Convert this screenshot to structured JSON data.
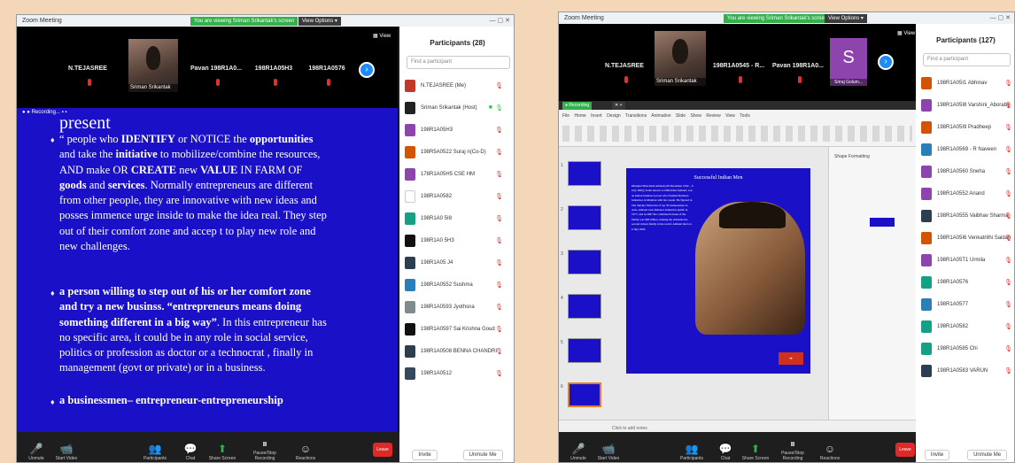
{
  "left": {
    "window_title": "Zoom Meeting",
    "banner": "You are viewing Sriman Srikantak's screen",
    "view_options": "View Options ▾",
    "gallery": [
      {
        "name": "N.TEJASREE"
      },
      {
        "name": "Sriman Srikantak"
      },
      {
        "name": "Pavan 198R1A0..."
      },
      {
        "name": "198R1A05H3"
      },
      {
        "name": "198R1A0576"
      }
    ],
    "view_label": "View",
    "recording": "Recording...",
    "slide": {
      "title": "present",
      "p1_l1_a": "“ people who ",
      "p1_l1_b": "IDENTIFY",
      "p1_l1_c": " or NOTICE the ",
      "p1_l1_d": "opportunities",
      "p1_l2_a": "and take the ",
      "p1_l2_b": "initiative",
      "p1_l2_c": " to mobilizee/combine the resources,",
      "p1_l3_a": "AND make OR ",
      "p1_l3_b": "CREATE",
      "p1_l3_c": " new ",
      "p1_l3_d": "VALUE",
      "p1_l3_e": " IN FARM OF",
      "p1_l4_a": "goods",
      "p1_l4_b": " and ",
      "p1_l4_c": "services",
      "p1_l4_d": ". Normally  entrepreneurs are  different",
      "p1_l5": "from other people, they are innovative with new  ideas and",
      "p1_l6": "posses immence urge inside to make the idea real.  They step",
      "p1_l7": "out of their comfort zone and accep t to play new role and",
      "p1_l8": "new challenges.",
      "p2_l1": "a person   willing to step out of his or her comfort zone",
      "p2_l2": "and try a new businss. “entrepreneurs means doing",
      "p2_l3_a": "something different in a big way”",
      "p2_l3_b": ". In this  entrepreneur has",
      "p2_l4": "no specific area, it could be in any role in social  service,",
      "p2_l5": "politics or profession as doctor or a technocrat , finally  in",
      "p2_l6": "management (govt or private) or in a business.",
      "p3": "a businessmen– entrepreneur-entrepreneurship"
    },
    "participants_title": "Participants (28)",
    "find_placeholder": "Find a participant",
    "participants": [
      {
        "name": "N.TEJASREE (Me)",
        "color": "#c0392b"
      },
      {
        "name": "Sriman Srikantak (Host)",
        "color": "#222222"
      },
      {
        "name": "198R1A05H3",
        "color": "#8e44ad"
      },
      {
        "name": "198R5A0522 Suraj n(Co-D)",
        "color": "#d35400"
      },
      {
        "name": "178R1A05H5 CSE HM",
        "color": "#8e44ad"
      },
      {
        "name": "198R1A0582",
        "color": "#ffffff"
      },
      {
        "name": "198R1A0 5I8",
        "color": "#16a085"
      },
      {
        "name": "198R1A0 5H3",
        "color": "#111111"
      },
      {
        "name": "198R1A05 J4",
        "color": "#2c3e50"
      },
      {
        "name": "198R1A0552 Sushma",
        "color": "#2980b9"
      },
      {
        "name": "198R1A0593 Jyothsna",
        "color": "#7f8c8d"
      },
      {
        "name": "198R1A0597 Sai Krishna Goud",
        "color": "#111111"
      },
      {
        "name": "198R1A0508 BENNA CHANDRI",
        "color": "#2c3e50"
      },
      {
        "name": "198R1A0512",
        "color": "#34495e"
      }
    ],
    "invite": "Invite",
    "unmute_me": "Unmute Me",
    "controls": [
      {
        "label": "Unmute",
        "icon": "🎤"
      },
      {
        "label": "Start Video",
        "icon": "📹"
      },
      {
        "label": "Participants",
        "icon": "👥"
      },
      {
        "label": "Chat",
        "icon": "💬"
      },
      {
        "label": "Share Screen",
        "icon": "⬆"
      },
      {
        "label": "Pause/Stop Recording",
        "icon": "⏸"
      },
      {
        "label": "Reactions",
        "icon": "☺"
      }
    ],
    "leave": "Leave"
  },
  "right": {
    "window_title": "Zoom Meeting",
    "banner": "You are viewing Sriman Srikantak's screen",
    "view_options": "View Options ▾",
    "gallery": [
      {
        "name": "N.TEJASREE"
      },
      {
        "name": "Sriman Srikantak"
      },
      {
        "name": "198R1A0545 - R..."
      },
      {
        "name": "Pavan 198R1A0..."
      },
      {
        "name": "S"
      }
    ],
    "s_tile_name": "Sriraj Golum...",
    "view_label": "View",
    "recording": "Recording",
    "ppt_menu": "File  Home  Insert  Design  Transitions  Animation  Slide Show  Review  View  Tools",
    "slide_title": "Successful Indian Men",
    "slide_body": "Dhirajlal Hirachand Ambani (28 December 1932 – 6 July 2002), better known as Dhirubhai Ambani, was an Indian business tycoon who founded Reliance Industries in Mumbai with his cousin. He figured in The Sunday Times list of top 50 businessmen in Asia. Ambani took Reliance Industries public in 1977, and in 2007 the combined fortune of the family was $60 billion, making the Ambanis the second richest family in the world. Ambani died on 6 July 2002.",
    "format_title": "Shape Formatting",
    "click_notes": "Click to add notes",
    "participants_title": "Participants (127)",
    "find_placeholder": "Find a participant",
    "participants": [
      {
        "name": "198R1A05I1 Abhinav",
        "color": "#d35400"
      },
      {
        "name": "198R1A05I8 Varshini_Aboraby",
        "color": "#8e44ad"
      },
      {
        "name": "198R1A05I9 Pradheep",
        "color": "#d35400"
      },
      {
        "name": "198R1A0569 - R Naveen",
        "color": "#2980b9"
      },
      {
        "name": "198R1A0560 Sneha",
        "color": "#8e44ad"
      },
      {
        "name": "198R1A0552 Anand",
        "color": "#8e44ad"
      },
      {
        "name": "198R1A0555 Vaibhav Sharma",
        "color": "#2c3e50"
      },
      {
        "name": "198R1A05I6 Venkatrithi Saidan",
        "color": "#d35400"
      },
      {
        "name": "198R1A05T1 Urmila",
        "color": "#8e44ad"
      },
      {
        "name": "198R1A0576",
        "color": "#16a085"
      },
      {
        "name": "198R1A0577",
        "color": "#2980b9"
      },
      {
        "name": "198R1A0582",
        "color": "#16a085"
      },
      {
        "name": "198R1A0585 Chi",
        "color": "#16a085"
      },
      {
        "name": "198R1A0583 VARUN",
        "color": "#2c3e50"
      }
    ],
    "invite": "Invite",
    "unmute_me": "Unmute Me",
    "controls": [
      {
        "label": "Unmute",
        "icon": "🎤"
      },
      {
        "label": "Start Video",
        "icon": "📹"
      },
      {
        "label": "Participants",
        "icon": "👥"
      },
      {
        "label": "Chat",
        "icon": "💬"
      },
      {
        "label": "Share Screen",
        "icon": "⬆"
      },
      {
        "label": "Pause/Stop Recording",
        "icon": "⏸"
      },
      {
        "label": "Reactions",
        "icon": "☺"
      }
    ],
    "leave": "Leave"
  }
}
